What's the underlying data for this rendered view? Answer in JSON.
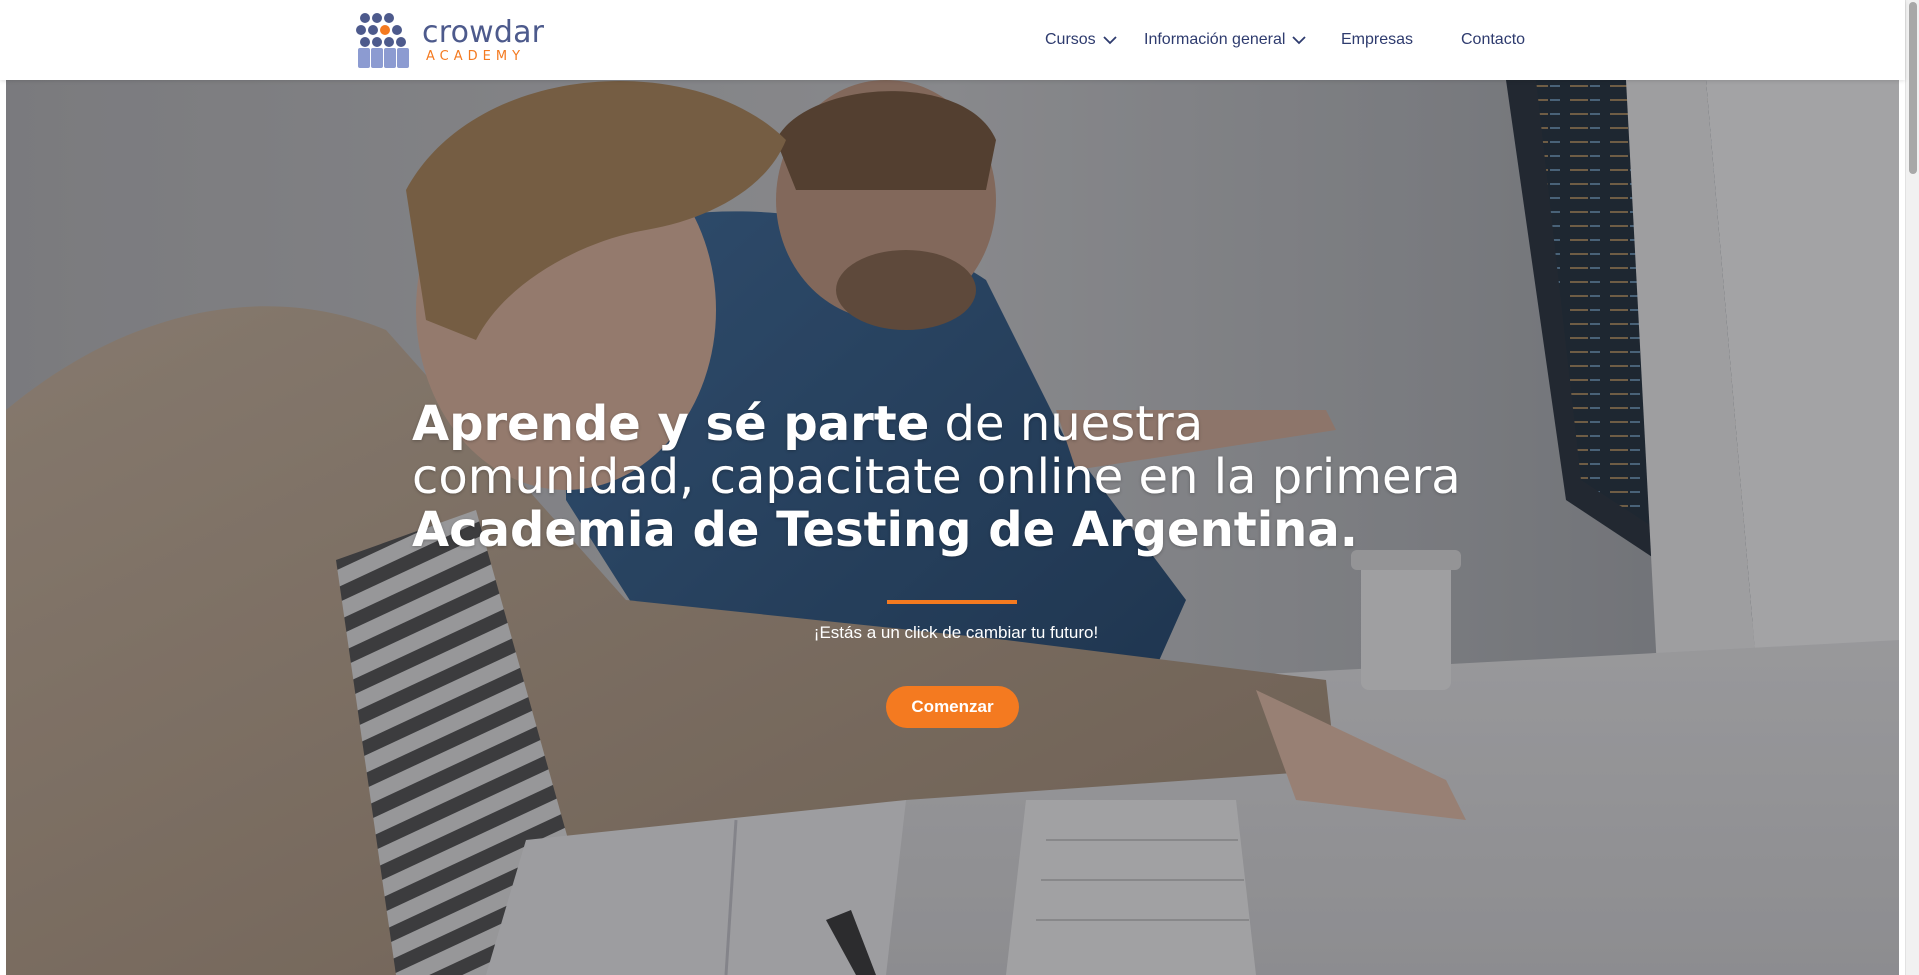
{
  "brand": {
    "name": "crowdar",
    "subtitle": "ACADEMY",
    "colors": {
      "primary": "#4d5a8c",
      "accent": "#f47a20"
    }
  },
  "nav": {
    "items": [
      {
        "label": "Cursos",
        "has_dropdown": true,
        "icon": "chevron-down-icon"
      },
      {
        "label": "Información general",
        "has_dropdown": true,
        "icon": "chevron-down-icon"
      },
      {
        "label": "Empresas",
        "has_dropdown": false
      },
      {
        "label": "Contacto",
        "has_dropdown": false
      }
    ]
  },
  "hero": {
    "headline": {
      "bold_1": "Aprende y sé parte",
      "regular_1": " de nuestra comunidad, capacitate online en la primera ",
      "bold_2": "Academia de Testing de Argentina."
    },
    "tagline": "¡Estás a un click de cambiar tu futuro!",
    "cta_label": "Comenzar",
    "background": "photo-two-people-working-at-computer-desk"
  }
}
